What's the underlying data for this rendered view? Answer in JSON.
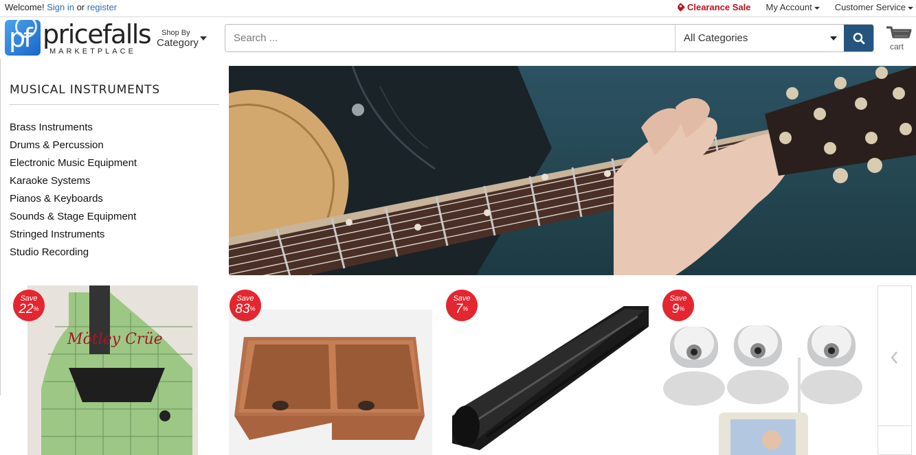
{
  "topbar": {
    "welcome": "Welcome!",
    "sign_in": "Sign in",
    "or": "or",
    "register": "register",
    "clearance": "Clearance Sale",
    "my_account": "My Account",
    "customer_service": "Customer Service"
  },
  "header": {
    "logo_mark": "pf",
    "logo_name": "pricefalls",
    "logo_sub": "MARKETPLACE",
    "shop_by_small": "Shop By",
    "shop_by_big": "Category",
    "search_placeholder": "Search ...",
    "category_selected": "All Categories",
    "cart_label": "cart"
  },
  "sidebar": {
    "title": "MUSICAL INSTRUMENTS",
    "items": [
      "Brass Instruments",
      "Drums & Percussion",
      "Electronic Music Equipment",
      "Karaoke Systems",
      "Pianos & Keyboards",
      "Sounds & Stage Equipment",
      "Stringed Instruments",
      "Studio Recording"
    ]
  },
  "products": [
    {
      "save_label": "Save",
      "save_value": "22",
      "icon": "signed-electric-guitar"
    },
    {
      "save_label": "Save",
      "save_value": "83",
      "icon": "copper-double-sink"
    },
    {
      "save_label": "Save",
      "save_value": "7",
      "icon": "black-rubber-bar"
    },
    {
      "save_label": "Save",
      "save_value": "9",
      "icon": "vtech-baby-monitor-set"
    }
  ],
  "colors": {
    "link": "#2a6db5",
    "clearance": "#c40f1f",
    "search_button": "#25547f",
    "badge": "#e3262f"
  }
}
